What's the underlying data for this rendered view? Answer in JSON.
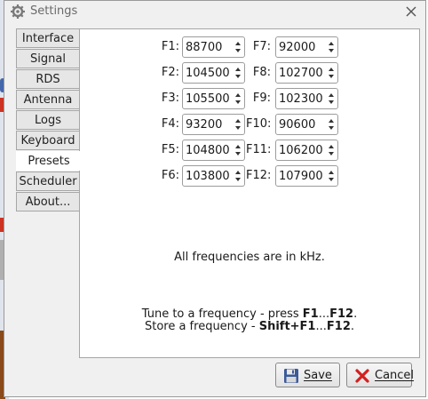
{
  "window": {
    "title": "Settings"
  },
  "tabs": [
    {
      "label": "Interface"
    },
    {
      "label": "Signal"
    },
    {
      "label": "RDS"
    },
    {
      "label": "Antenna"
    },
    {
      "label": "Logs"
    },
    {
      "label": "Keyboard"
    },
    {
      "label": "Presets",
      "selected": true
    },
    {
      "label": "Scheduler"
    },
    {
      "label": "About..."
    }
  ],
  "presets": [
    {
      "label": "F1:",
      "value": "88700"
    },
    {
      "label": "F2:",
      "value": "104500"
    },
    {
      "label": "F3:",
      "value": "105500"
    },
    {
      "label": "F4:",
      "value": "93200"
    },
    {
      "label": "F5:",
      "value": "104800"
    },
    {
      "label": "F6:",
      "value": "103800"
    },
    {
      "label": "F7:",
      "value": "92000"
    },
    {
      "label": "F8:",
      "value": "102700"
    },
    {
      "label": "F9:",
      "value": "102300"
    },
    {
      "label": "F10:",
      "value": "90600"
    },
    {
      "label": "F11:",
      "value": "106200"
    },
    {
      "label": "F12:",
      "value": "107900"
    }
  ],
  "notes": {
    "units": "All frequencies are in kHz.",
    "tune_prefix": "Tune to a frequency - press ",
    "tune_key1": "F1",
    "tune_sep": "...",
    "tune_key2": "F12",
    "tune_suffix": ".",
    "store_prefix": "Store a frequency - ",
    "store_key1": "Shift+F1",
    "store_sep": "...",
    "store_key2": "F12",
    "store_suffix": "."
  },
  "buttons": {
    "save": "Save",
    "cancel": "Cancel"
  },
  "colors": {
    "window_bg": "#f0f0f0",
    "panel_bg": "#ffffff",
    "cancel_icon": "#d42020",
    "save_icon": "#3a5a9a"
  }
}
